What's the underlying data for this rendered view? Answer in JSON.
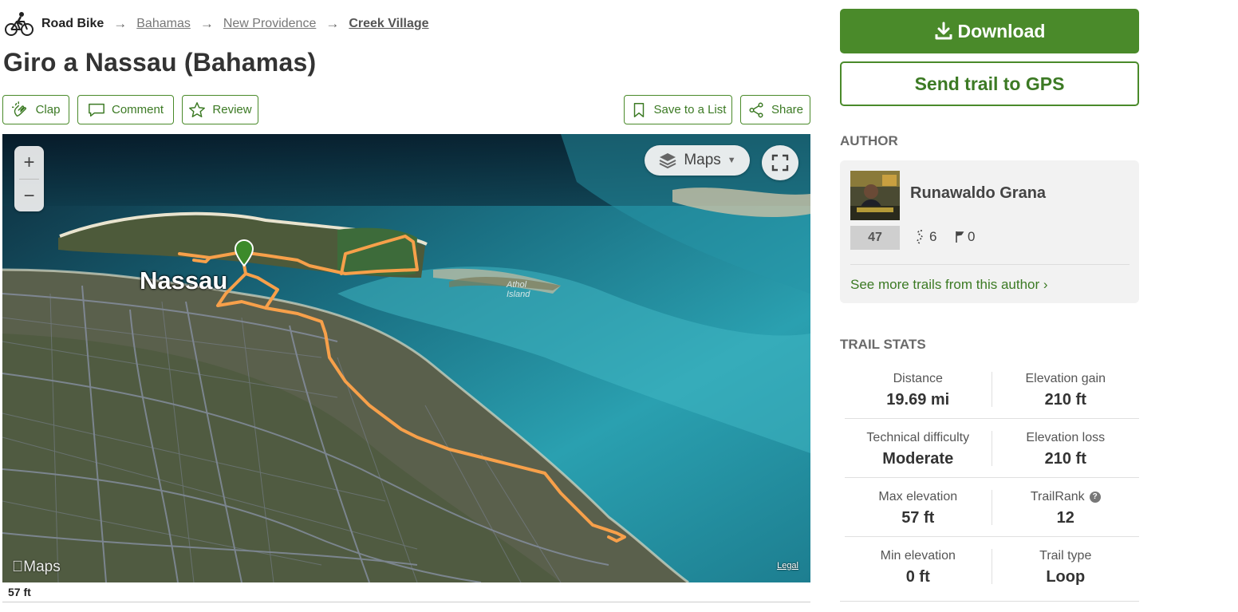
{
  "breadcrumb": {
    "activity": "Road Bike",
    "arrow": "→",
    "items": [
      "Bahamas",
      "New Providence",
      "Creek Village"
    ]
  },
  "title": "Giro a Nassau (Bahamas)",
  "actions": {
    "clap": "Clap",
    "comment": "Comment",
    "review": "Review",
    "save": "Save to a List",
    "share": "Share"
  },
  "map": {
    "zoom_in": "+",
    "zoom_out": "−",
    "layer_label": "Maps",
    "city_label": "Nassau",
    "island_label": "Athol Island",
    "attribution": "Maps",
    "legal": "Legal",
    "route_color": "#f7a04a",
    "marker_color": "#3c8a2a"
  },
  "elevation": {
    "current": "57 ft"
  },
  "sidebar": {
    "download_label": "Download",
    "gps_label": "Send trail to GPS",
    "author_heading": "AUTHOR",
    "author": {
      "name": "Runawaldo Grana",
      "rank": "47",
      "trails": "6",
      "flags": "0",
      "more_link": "See more trails from this author ›"
    },
    "stats_heading": "TRAIL STATS",
    "stats": [
      {
        "label": "Distance",
        "value": "19.69 mi"
      },
      {
        "label": "Elevation gain",
        "value": "210 ft"
      },
      {
        "label": "Technical difficulty",
        "value": "Moderate"
      },
      {
        "label": "Elevation loss",
        "value": "210 ft"
      },
      {
        "label": "Max elevation",
        "value": "57 ft"
      },
      {
        "label": "TrailRank",
        "value": "12"
      },
      {
        "label": "Min elevation",
        "value": "0 ft"
      },
      {
        "label": "Trail type",
        "value": "Loop"
      }
    ]
  },
  "colors": {
    "brand_green": "#4a8a2a",
    "brand_green_text": "#3c7a24"
  }
}
